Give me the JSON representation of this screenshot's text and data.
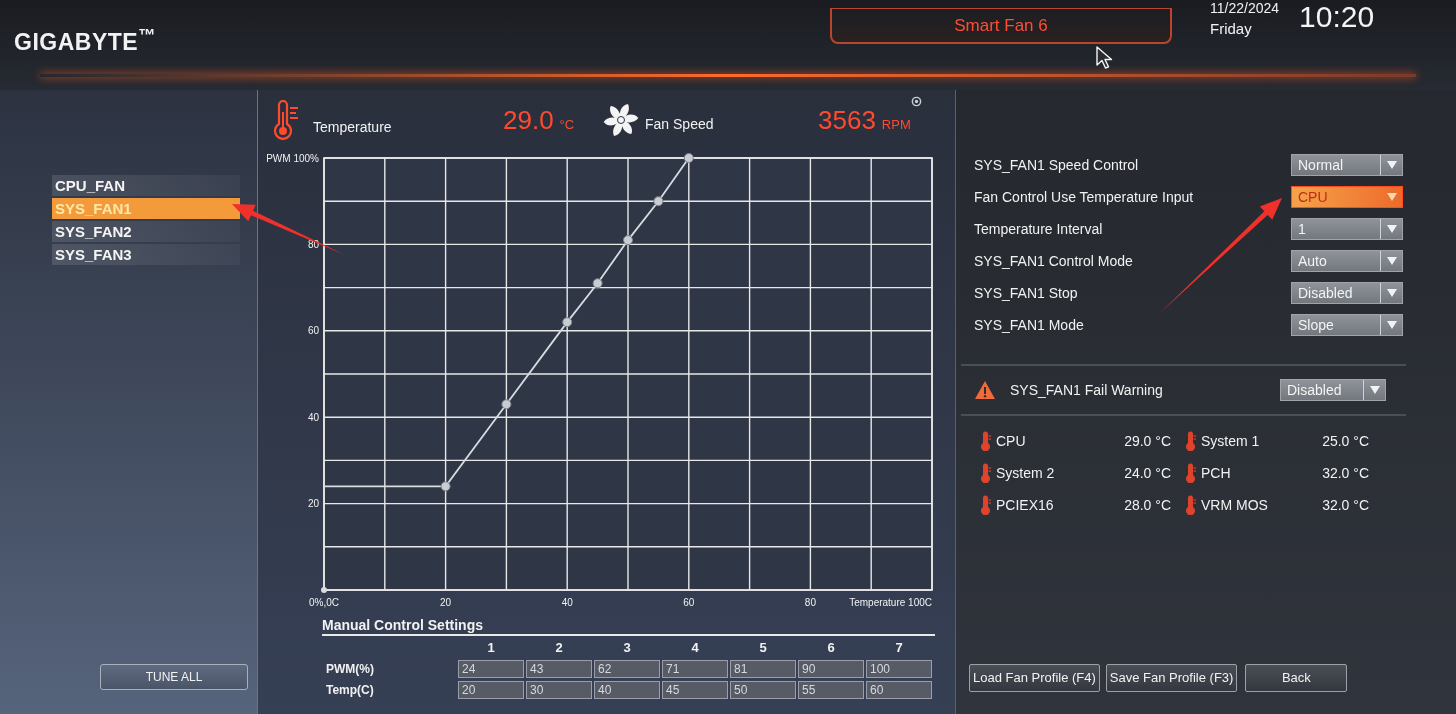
{
  "header": {
    "logo": "GIGABYTE$^{™}$",
    "tab": "Smart Fan 6",
    "date": "11/22/2024",
    "weekday": "Friday",
    "time": "10:20"
  },
  "readouts": {
    "temperature": {
      "label": "Temperature",
      "value": "29.0",
      "unit": "°C"
    },
    "fan_speed": {
      "label": "Fan Speed",
      "value": "3563",
      "unit": "RPM"
    }
  },
  "fans": [
    {
      "label": "CPU_FAN",
      "selected": false
    },
    {
      "label": "SYS_FAN1",
      "selected": true
    },
    {
      "label": "SYS_FAN2",
      "selected": false
    },
    {
      "label": "SYS_FAN3",
      "selected": false
    }
  ],
  "tune_all": "TUNE ALL",
  "curve": {
    "chart_data": {
      "type": "line",
      "x": [
        0,
        20,
        30,
        40,
        45,
        50,
        55,
        60
      ],
      "values": [
        24,
        24,
        43,
        62,
        71,
        81,
        90,
        100
      ],
      "xlim": [
        0,
        100
      ],
      "ylim": [
        0,
        100
      ],
      "xticks": [
        {
          "value": 0,
          "label": "0%,0C"
        },
        20,
        40,
        60,
        80,
        {
          "value": 100,
          "label": "Temperature 100C"
        }
      ],
      "yticks": [
        20,
        40,
        60,
        80,
        {
          "value": 100,
          "label": "PWM 100%"
        }
      ],
      "grid": true,
      "marker": true
    }
  },
  "manual_settings": {
    "title": "Manual Control Settings",
    "columns": [
      "1",
      "2",
      "3",
      "4",
      "5",
      "6",
      "7"
    ],
    "rows": [
      {
        "label": "PWM(%)",
        "values": [
          "24",
          "43",
          "62",
          "71",
          "81",
          "90",
          "100"
        ]
      },
      {
        "label": "Temp(C)",
        "values": [
          "20",
          "30",
          "40",
          "45",
          "50",
          "55",
          "60"
        ]
      }
    ]
  },
  "settings": [
    {
      "label": "SYS_FAN1 Speed Control",
      "value": "Normal",
      "selected": false
    },
    {
      "label": "Fan Control Use Temperature Input",
      "value": "CPU",
      "selected": true
    },
    {
      "label": "Temperature Interval",
      "value": "1",
      "selected": false
    },
    {
      "label": "SYS_FAN1 Control Mode",
      "value": "Auto",
      "selected": false
    },
    {
      "label": "SYS_FAN1 Stop",
      "value": "Disabled",
      "selected": false
    },
    {
      "label": "SYS_FAN1 Mode",
      "value": "Slope",
      "selected": false
    }
  ],
  "fail_warning": {
    "label": "SYS_FAN1 Fail Warning",
    "value": "Disabled"
  },
  "temperatures": [
    {
      "name": "CPU",
      "value": "29.0 °C"
    },
    {
      "name": "System 1",
      "value": "25.0 °C"
    },
    {
      "name": "System 2",
      "value": "24.0 °C"
    },
    {
      "name": "PCH",
      "value": "32.0 °C"
    },
    {
      "name": "PCIEX16",
      "value": "28.0 °C"
    },
    {
      "name": "VRM MOS",
      "value": "32.0 °C"
    }
  ],
  "buttons": [
    "Load Fan Profile (F4)",
    "Save Fan Profile (F3)",
    "Back"
  ]
}
